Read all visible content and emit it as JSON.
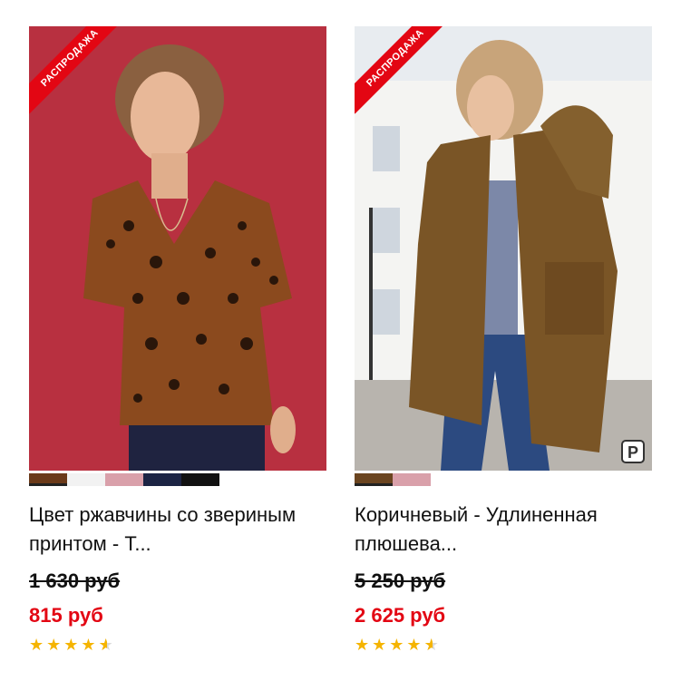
{
  "products": [
    {
      "badge": "РАСПРОДАЖА",
      "title": "Цвет ржавчины со звериным принтом - Т...",
      "old_price": "1 630 руб",
      "new_price": "815 руб",
      "rating_stars": 4.5,
      "swatches": [
        "#6b3a1a",
        "#f2f2f2",
        "#d9a0aa",
        "#1c2444",
        "#111111"
      ],
      "selected_swatch": 0
    },
    {
      "badge": "РАСПРОДАЖА",
      "title": "Коричневый - Удлиненная плюшева...",
      "old_price": "5 250 руб",
      "new_price": "2 625 руб",
      "rating_stars": 4.5,
      "swatches": [
        "#6b4520",
        "#d9a0aa"
      ],
      "selected_swatch": 0,
      "corner_icon": "P"
    }
  ],
  "colors": {
    "sale_red": "#e30613",
    "star": "#f5b400"
  }
}
